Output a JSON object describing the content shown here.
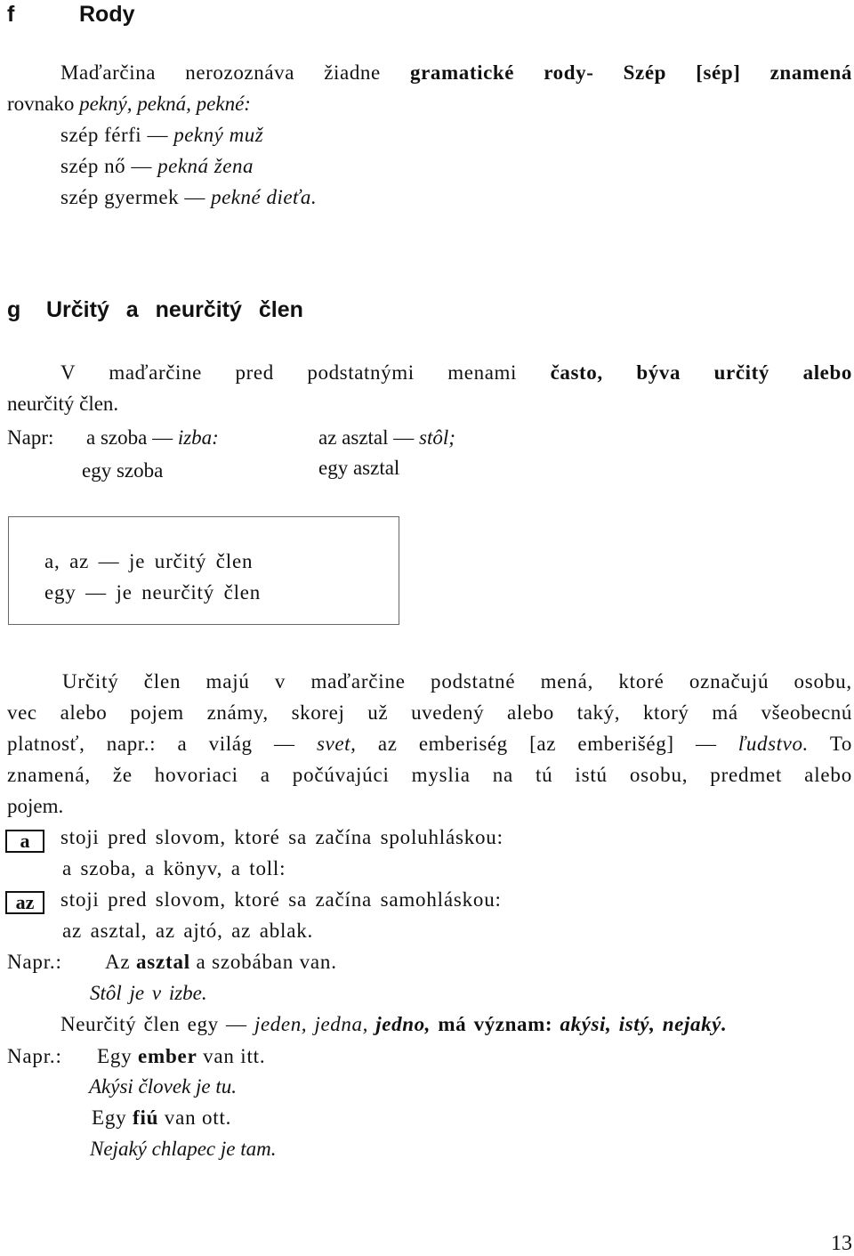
{
  "section_f": {
    "letter": "f",
    "title": "Rody",
    "para": {
      "t1": "Maďarčina nerozoznáva žiadne ",
      "b1": "gramatické rody- Szép [sép] znamená",
      "t2": "rovnako ",
      "i1": "pekný, pekná, pekné:"
    },
    "examples": [
      {
        "hu": "szép férfi — ",
        "sk": "pekný muž"
      },
      {
        "hu": "szép nő — ",
        "sk": "pekná žena"
      },
      {
        "hu": "szép gyermek — ",
        "sk": "pekné dieťa."
      }
    ]
  },
  "section_g": {
    "letter": "g",
    "title": "Určitý a neurčitý člen",
    "intro": {
      "t1": "V maďarčine pred podstatnými menami ",
      "b1": "často, býva určitý alebo",
      "t2": "neurčitý člen."
    },
    "napr_label": "Napr:",
    "ex_left_1": {
      "hu": "a szoba — ",
      "sk": "izba:"
    },
    "ex_left_2": "egy szoba",
    "ex_right_1": {
      "hu": "az asztal — ",
      "sk": "stôl;"
    },
    "ex_right_2": "egy asztal",
    "box": {
      "line1": "a, az — je určitý člen",
      "line2": "egy — je neurčitý člen"
    },
    "para2": {
      "l1": "Určitý člen majú v maďarčine podstatné mená, ktoré označujú osobu,",
      "l2": "vec alebo pojem známy, skorej už uvedený alebo taký, ktorý má všeobecnú",
      "l3a": "platnosť, napr.: a világ — ",
      "l3b": "svet,",
      "l3c": " az emberiség [az emberišég] — ",
      "l3d": "ľudstvo.",
      "l3e": " To",
      "l4": "znamená, že hovoriaci a počúvajúci myslia na tú istú osobu, predmet alebo",
      "l5": "pojem."
    },
    "rule_a": {
      "tag": "a",
      "text": "stoji pred slovom, ktoré sa začína spoluhláskou:",
      "examples": "a szoba, a könyv, a toll:"
    },
    "rule_az": {
      "tag": "az",
      "text": "stoji pred slovom, ktoré sa začína samohláskou:",
      "examples": "az asztal, az ajtó, az ablak."
    },
    "napr2": {
      "label": "Napr.:",
      "t1": "Az ",
      "b1": "asztal",
      "t2": " a szobában van.",
      "translation": "Stôl je v izbe."
    },
    "indef": {
      "t1": "Neurčitý člen egy — ",
      "i1": "jeden, jedna, ",
      "bi1": "jedno,",
      "b1": " má význam: ",
      "bi2": "akýsi, istý, nejaký."
    },
    "napr3": {
      "label": "Napr.:",
      "s1a": "Egy ",
      "s1b": "ember",
      "s1c": " van itt.",
      "s1t": "Akýsi človek je tu.",
      "s2a": "Egy ",
      "s2b": "fiú",
      "s2c": " van ott.",
      "s2t": "Nejaký chlapec je tam."
    }
  },
  "page_number": "13"
}
